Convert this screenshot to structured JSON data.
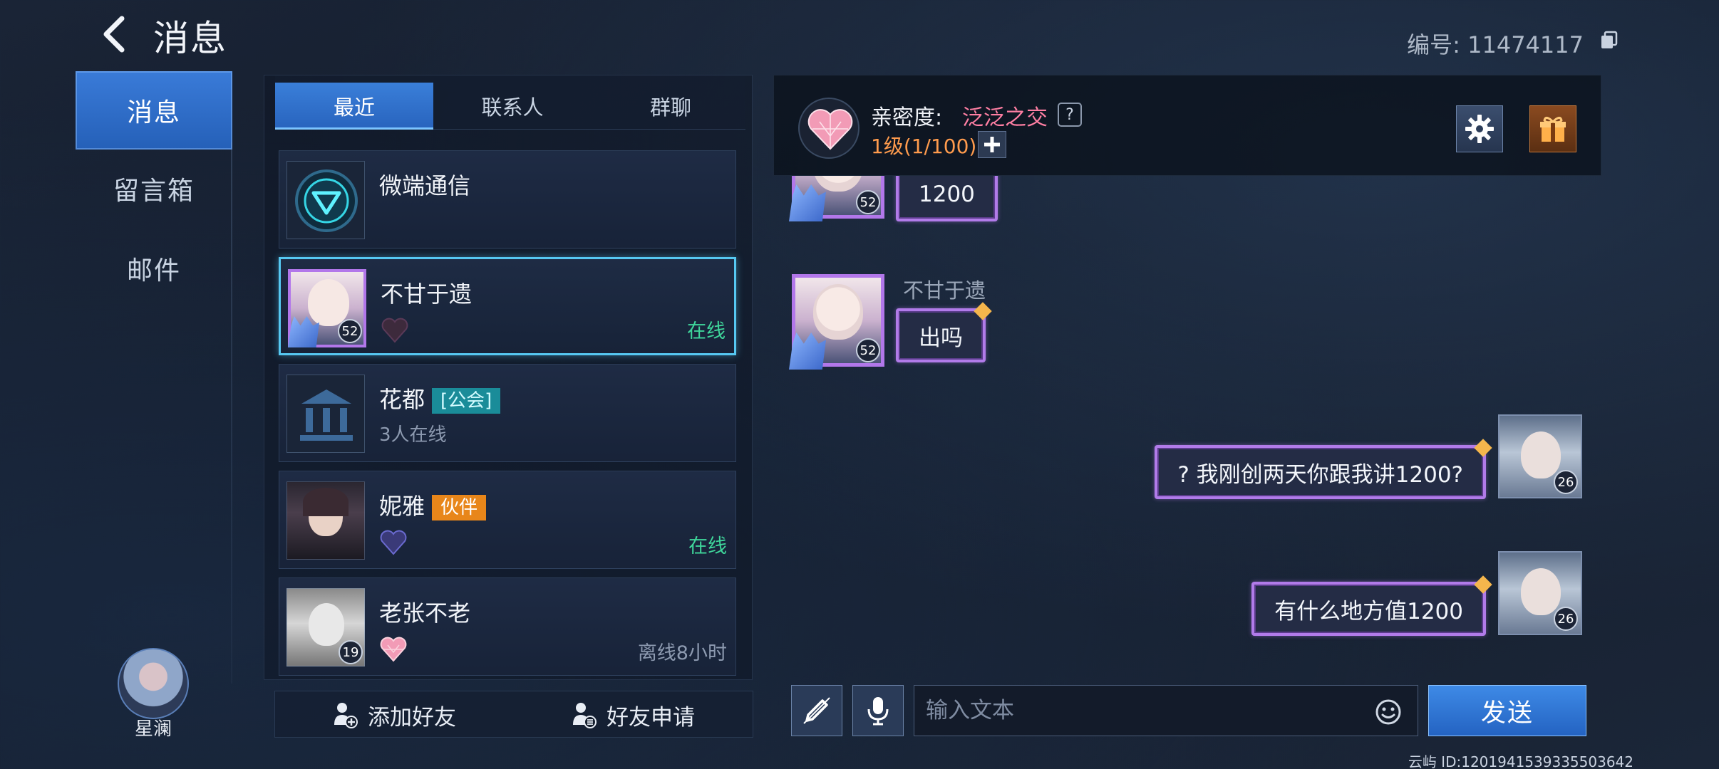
{
  "header": {
    "title": "消息",
    "user_number": "编号: 11474117"
  },
  "nav": {
    "items": [
      {
        "label": "消息",
        "active": true
      },
      {
        "label": "留言箱",
        "active": false
      },
      {
        "label": "邮件",
        "active": false
      }
    ]
  },
  "player": {
    "name": "星澜"
  },
  "tabs": [
    {
      "label": "最近",
      "active": true
    },
    {
      "label": "联系人",
      "active": false
    },
    {
      "label": "群聊",
      "active": false
    }
  ],
  "contacts": [
    {
      "name": "微端通信",
      "tag": "",
      "sub": "",
      "status": "",
      "level": ""
    },
    {
      "name": "不甘于遗",
      "tag": "",
      "sub": "",
      "status": "在线",
      "level": "52"
    },
    {
      "name": "花都",
      "tag": "[公会]",
      "sub": "3人在线",
      "status": "",
      "level": ""
    },
    {
      "name": "妮雅",
      "tag": "伙伴",
      "sub": "",
      "status": "在线",
      "level": ""
    },
    {
      "name": "老张不老",
      "tag": "",
      "sub": "",
      "status": "离线8小时",
      "level": "19"
    }
  ],
  "list_footer": {
    "add_friend": "添加好友",
    "friend_requests": "好友申请"
  },
  "chat_header": {
    "intimacy_label": "亲密度:",
    "intimacy_value": "泛泛之交",
    "help": "?",
    "level": "1级(1/100)"
  },
  "messages": [
    {
      "from": "other",
      "sender": "",
      "text": "1200",
      "level": "52"
    },
    {
      "from": "other",
      "sender": "不甘于遗",
      "text": "出吗",
      "level": "52"
    },
    {
      "from": "self",
      "sender": "云屿",
      "text": "? 我刚创两天你跟我讲1200?",
      "level": "26"
    },
    {
      "from": "self",
      "sender": "云屿",
      "text": "有什么地方值1200",
      "level": "26"
    }
  ],
  "input": {
    "placeholder": "输入文本",
    "send_label": "发送"
  },
  "footer_id": "云屿 ID:1201941539335503642",
  "colors": {
    "accent": "#2f74d0",
    "online": "#3fd69b",
    "bubble_border": "#b17be9",
    "intimacy": "#ff7fa3",
    "level": "#ff9b4d"
  }
}
